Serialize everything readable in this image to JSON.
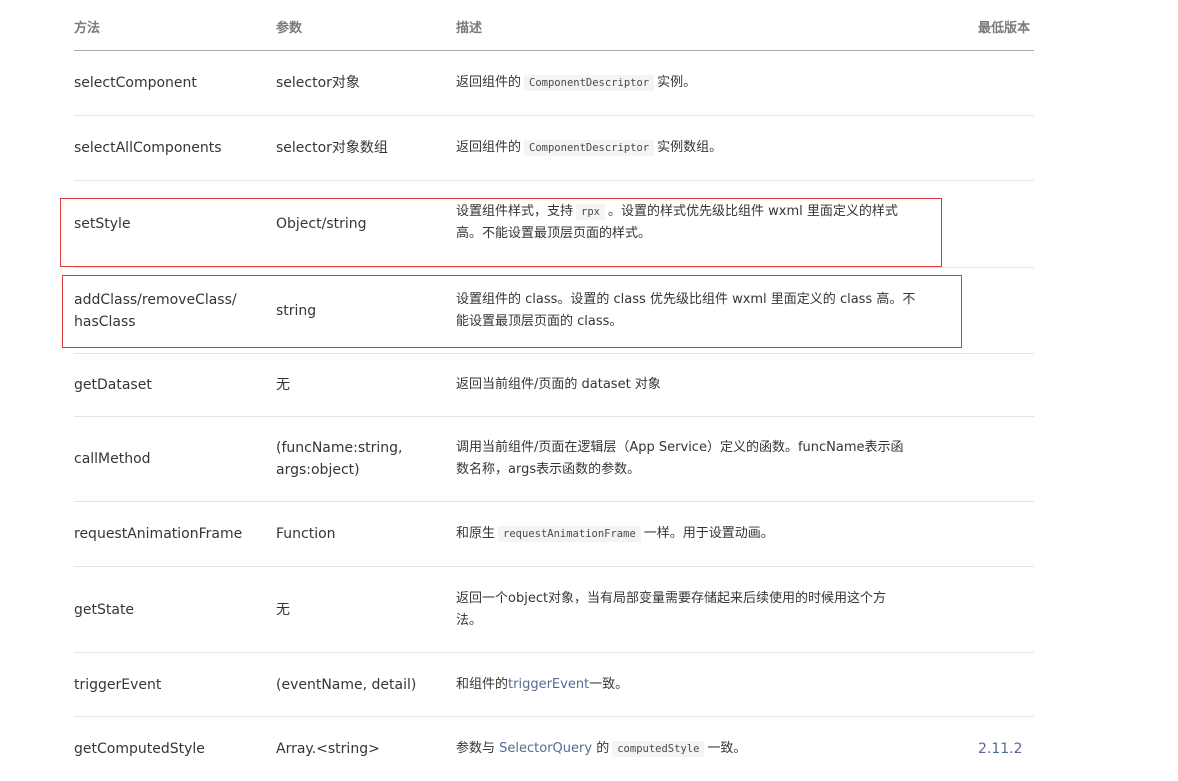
{
  "header": {
    "method": "方法",
    "param": "参数",
    "desc": "描述",
    "version": "最低版本"
  },
  "rows": [
    {
      "method": "selectComponent",
      "param": "selector对象",
      "desc_pre": "返回组件的",
      "desc_code": "ComponentDescriptor",
      "desc_post": "实例。",
      "version": ""
    },
    {
      "method": "selectAllComponents",
      "param": "selector对象数组",
      "desc_pre": "返回组件的",
      "desc_code": "ComponentDescriptor",
      "desc_post": "实例数组。",
      "version": ""
    },
    {
      "method": "setStyle",
      "param": "Object/string",
      "desc_line1_pre": "设置组件样式，支持",
      "desc_code": "rpx",
      "desc_line1_post": "。设置的样式优先级比组件 wxml 里面定义的样式",
      "desc_line2": "高。不能设置最顶层页面的样式。",
      "version": ""
    },
    {
      "method_line1": "addClass/removeClass/",
      "method_line2": "hasClass",
      "param": "string",
      "desc_line1": "设置组件的 class。设置的 class 优先级比组件 wxml 里面定义的 class 高。不",
      "desc_line2": "能设置最顶层页面的 class。",
      "version": ""
    },
    {
      "method": "getDataset",
      "param": "无",
      "desc": "返回当前组件/页面的 dataset 对象",
      "version": ""
    },
    {
      "method": "callMethod",
      "param_line1": "(funcName:string,",
      "param_line2": "args:object)",
      "desc_line1": "调用当前组件/页面在逻辑层（App Service）定义的函数。funcName表示函",
      "desc_line2": "数名称，args表示函数的参数。",
      "version": ""
    },
    {
      "method": "requestAnimationFrame",
      "param": "Function",
      "desc_pre": "和原生",
      "desc_code": "requestAnimationFrame",
      "desc_post": "一样。用于设置动画。",
      "version": ""
    },
    {
      "method": "getState",
      "param": "无",
      "desc_line1": "返回一个object对象，当有局部变量需要存储起来后续使用的时候用这个方",
      "desc_line2": "法。",
      "version": ""
    },
    {
      "method": "triggerEvent",
      "param": "(eventName, detail)",
      "desc_pre": "和组件的",
      "desc_link": "triggerEvent",
      "desc_post": "一致。",
      "version": ""
    },
    {
      "method": "getComputedStyle",
      "param": "Array.<string>",
      "desc_pre": "参数与",
      "desc_link": "SelectorQuery",
      "desc_mid": "的",
      "desc_code": "computedStyle",
      "desc_post": "一致。",
      "version": "2.11.2"
    }
  ],
  "colors": {
    "highlight_border": "#e03a3a",
    "link": "#576b95",
    "header_text": "#7b7b7b",
    "body_text": "#353535"
  }
}
